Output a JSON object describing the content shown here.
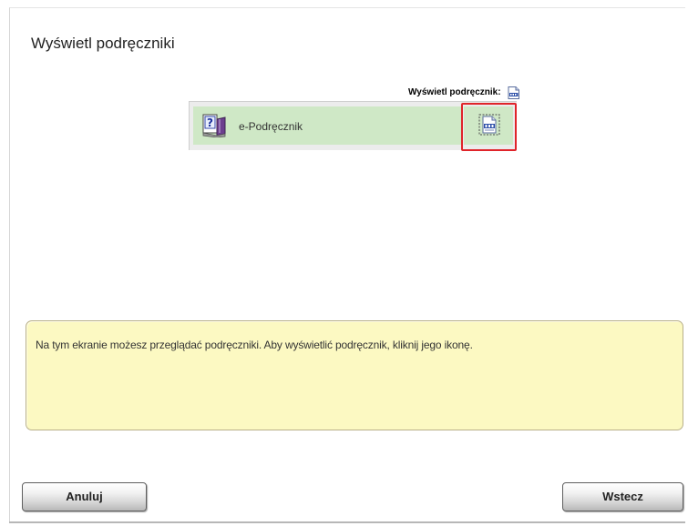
{
  "page": {
    "title": "Wyświetl podręczniki"
  },
  "manual_list": {
    "view_label": "Wyświetl podręcznik:",
    "items": [
      {
        "label": "e-Podręcznik",
        "icon": "help-book-icon",
        "view_icon": "pdf-icon",
        "view_highlighted": true
      }
    ]
  },
  "info": {
    "text": "Na tym ekranie możesz przeglądać podręczniki. Aby wyświetlić podręcznik, kliknij jego ikonę."
  },
  "buttons": {
    "cancel_label": "Anuluj",
    "back_label": "Wstecz"
  },
  "colors": {
    "item_background": "#cfe8c6",
    "highlight": "#e0242a",
    "info_background": "#fcf9c2"
  }
}
